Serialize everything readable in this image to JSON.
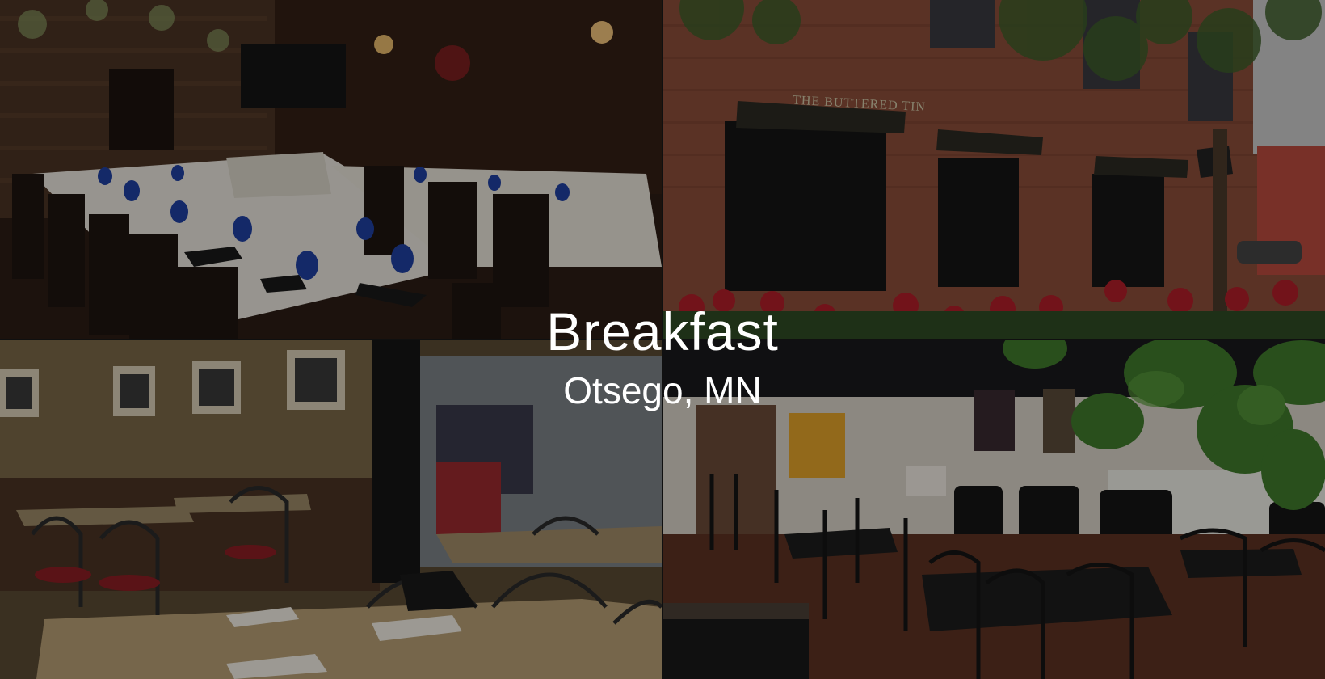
{
  "title": "Breakfast",
  "subtitle": "Otsego, MN",
  "photos": [
    {
      "name": "photo-dining-room",
      "description": "dining-room"
    },
    {
      "name": "photo-storefront",
      "description": "storefront"
    },
    {
      "name": "photo-diner-interior",
      "description": "diner-interior"
    },
    {
      "name": "photo-cafe-interior",
      "description": "cafe-interior"
    }
  ],
  "storefront_sign": "THE BUTTERED TIN"
}
